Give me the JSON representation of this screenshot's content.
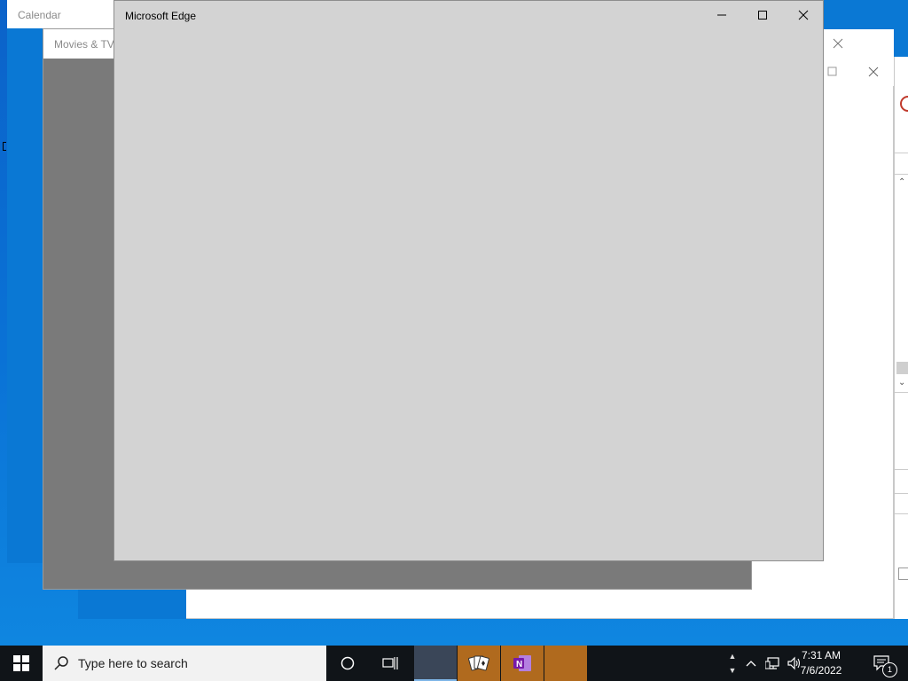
{
  "windows": {
    "calendar": {
      "title": "Calendar"
    },
    "movies": {
      "title": "Movies & TV"
    },
    "edge": {
      "title": "Microsoft Edge"
    }
  },
  "taskbar": {
    "search_placeholder": "Type here to search",
    "time": "7:31 AM",
    "date": "7/6/2022",
    "notification_count": "1",
    "apps": [
      {
        "icon": "blank-app-icon",
        "accent": "#3a4658"
      },
      {
        "icon": "solitaire-icon",
        "accent": "#b06a1e"
      },
      {
        "icon": "onenote-icon",
        "accent": "#b06a1e"
      },
      {
        "icon": "blank-app-icon",
        "accent": "#b06a1e"
      }
    ]
  },
  "colors": {
    "desktop": "#0a6fd1",
    "taskbar": "#101418",
    "edge_body": "#d3d3d3",
    "movies_body": "#7a7a7a",
    "running_app_highlight": "#b06a1e"
  }
}
